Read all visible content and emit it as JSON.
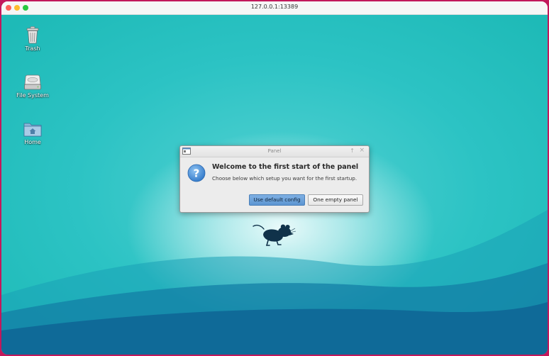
{
  "browser": {
    "url": "127.0.0.1:13389"
  },
  "desktop_icons": [
    {
      "label": "Trash",
      "icon": "trash-icon"
    },
    {
      "label": "File System",
      "icon": "drive-icon"
    },
    {
      "label": "Home",
      "icon": "home-folder-icon"
    }
  ],
  "dialog": {
    "window_title": "Panel",
    "heading": "Welcome to the first start of the panel",
    "description": "Choose below which setup you want for the first startup.",
    "buttons": {
      "default_config": "Use default config",
      "empty_panel": "One empty panel"
    },
    "icons": [
      "panel-app-icon",
      "question-icon",
      "pin-up-icon",
      "close-icon"
    ]
  },
  "wallpaper": {
    "logo": "xfce-mouse-logo"
  },
  "colors": {
    "frame": "#c2185b",
    "desktop_teal": "#2cc3c4",
    "default_button": "#6aa0d8"
  }
}
